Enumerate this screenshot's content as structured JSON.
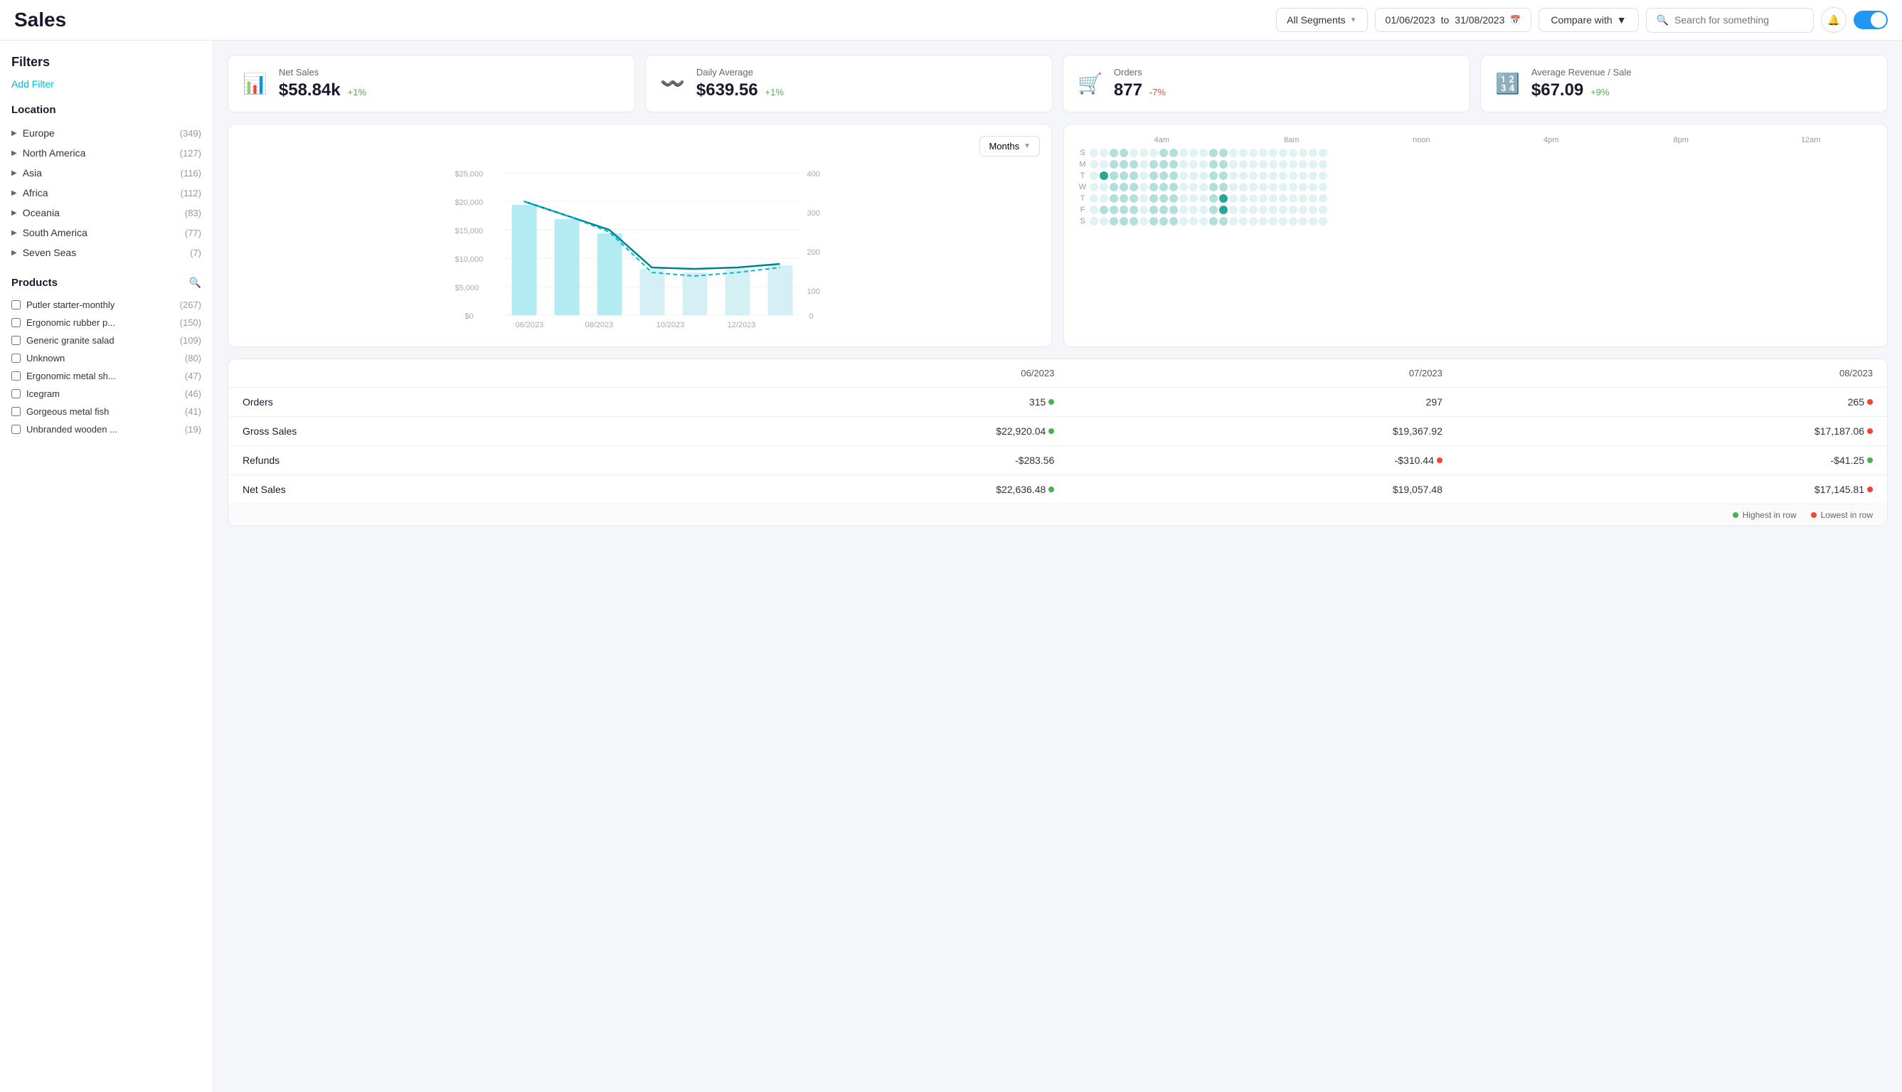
{
  "header": {
    "title": "Sales",
    "segment_label": "All Segments",
    "date_from": "01/06/2023",
    "date_to": "31/08/2023",
    "date_separator": "to",
    "compare_label": "Compare with",
    "search_placeholder": "Search for something"
  },
  "kpis": [
    {
      "id": "net-sales",
      "label": "Net Sales",
      "value": "$58.84k",
      "change": "+1%",
      "positive": true,
      "icon": "bar-chart"
    },
    {
      "id": "daily-avg",
      "label": "Daily Average",
      "value": "$639.56",
      "change": "+1%",
      "positive": true,
      "icon": "wave"
    },
    {
      "id": "orders",
      "label": "Orders",
      "value": "877",
      "change": "-7%",
      "positive": false,
      "icon": "cart"
    },
    {
      "id": "avg-revenue",
      "label": "Average Revenue / Sale",
      "value": "$67.09",
      "change": "+9%",
      "positive": true,
      "icon": "number"
    }
  ],
  "chart": {
    "months_label": "Months",
    "x_labels": [
      "06/2023",
      "08/2023",
      "10/2023",
      "12/2023"
    ],
    "y_labels_left": [
      "$25,000",
      "$20,000",
      "$15,000",
      "$10,000",
      "$5,000",
      "$0"
    ],
    "y_labels_right": [
      "400",
      "300",
      "200",
      "100",
      "0"
    ]
  },
  "filters": {
    "title": "Filters",
    "add_filter": "Add Filter"
  },
  "location": {
    "title": "Location",
    "items": [
      {
        "name": "Europe",
        "count": "(349)"
      },
      {
        "name": "North America",
        "count": "(127)"
      },
      {
        "name": "Asia",
        "count": "(116)"
      },
      {
        "name": "Africa",
        "count": "(112)"
      },
      {
        "name": "Oceania",
        "count": "(83)"
      },
      {
        "name": "South America",
        "count": "(77)"
      },
      {
        "name": "Seven Seas",
        "count": "(7)"
      }
    ]
  },
  "products": {
    "title": "Products",
    "items": [
      {
        "name": "Putler starter-monthly",
        "count": "(267)"
      },
      {
        "name": "Ergonomic rubber p...",
        "count": "(150)"
      },
      {
        "name": "Generic granite salad",
        "count": "(109)"
      },
      {
        "name": "Unknown",
        "count": "(80)"
      },
      {
        "name": "Ergonomic metal sh...",
        "count": "(47)"
      },
      {
        "name": "Icegram",
        "count": "(46)"
      },
      {
        "name": "Gorgeous metal fish",
        "count": "(41)"
      },
      {
        "name": "Unbranded wooden ...",
        "count": "(19)"
      }
    ]
  },
  "dot_chart": {
    "time_labels": [
      "4am",
      "8am",
      "noon",
      "4pm",
      "8pm",
      "12am"
    ],
    "rows": [
      "S",
      "M",
      "T",
      "W",
      "T",
      "F",
      "S"
    ]
  },
  "table": {
    "columns": [
      "",
      "06/2023",
      "07/2023",
      "08/2023"
    ],
    "rows": [
      {
        "label": "Orders",
        "values": [
          {
            "text": "315",
            "dot": "green"
          },
          {
            "text": "297",
            "dot": null
          },
          {
            "text": "265",
            "dot": "red"
          }
        ]
      },
      {
        "label": "Gross Sales",
        "values": [
          {
            "text": "$22,920.04",
            "dot": "green"
          },
          {
            "text": "$19,367.92",
            "dot": null
          },
          {
            "text": "$17,187.06",
            "dot": "red"
          }
        ]
      },
      {
        "label": "Refunds",
        "values": [
          {
            "text": "-$283.56",
            "dot": null
          },
          {
            "text": "-$310.44",
            "dot": "red"
          },
          {
            "text": "-$41.25",
            "dot": "green"
          }
        ]
      },
      {
        "label": "Net Sales",
        "values": [
          {
            "text": "$22,636.48",
            "dot": "green"
          },
          {
            "text": "$19,057.48",
            "dot": null
          },
          {
            "text": "$17,145.81",
            "dot": "red"
          }
        ]
      }
    ],
    "legend_highest": "Highest in row",
    "legend_lowest": "Lowest in row"
  }
}
